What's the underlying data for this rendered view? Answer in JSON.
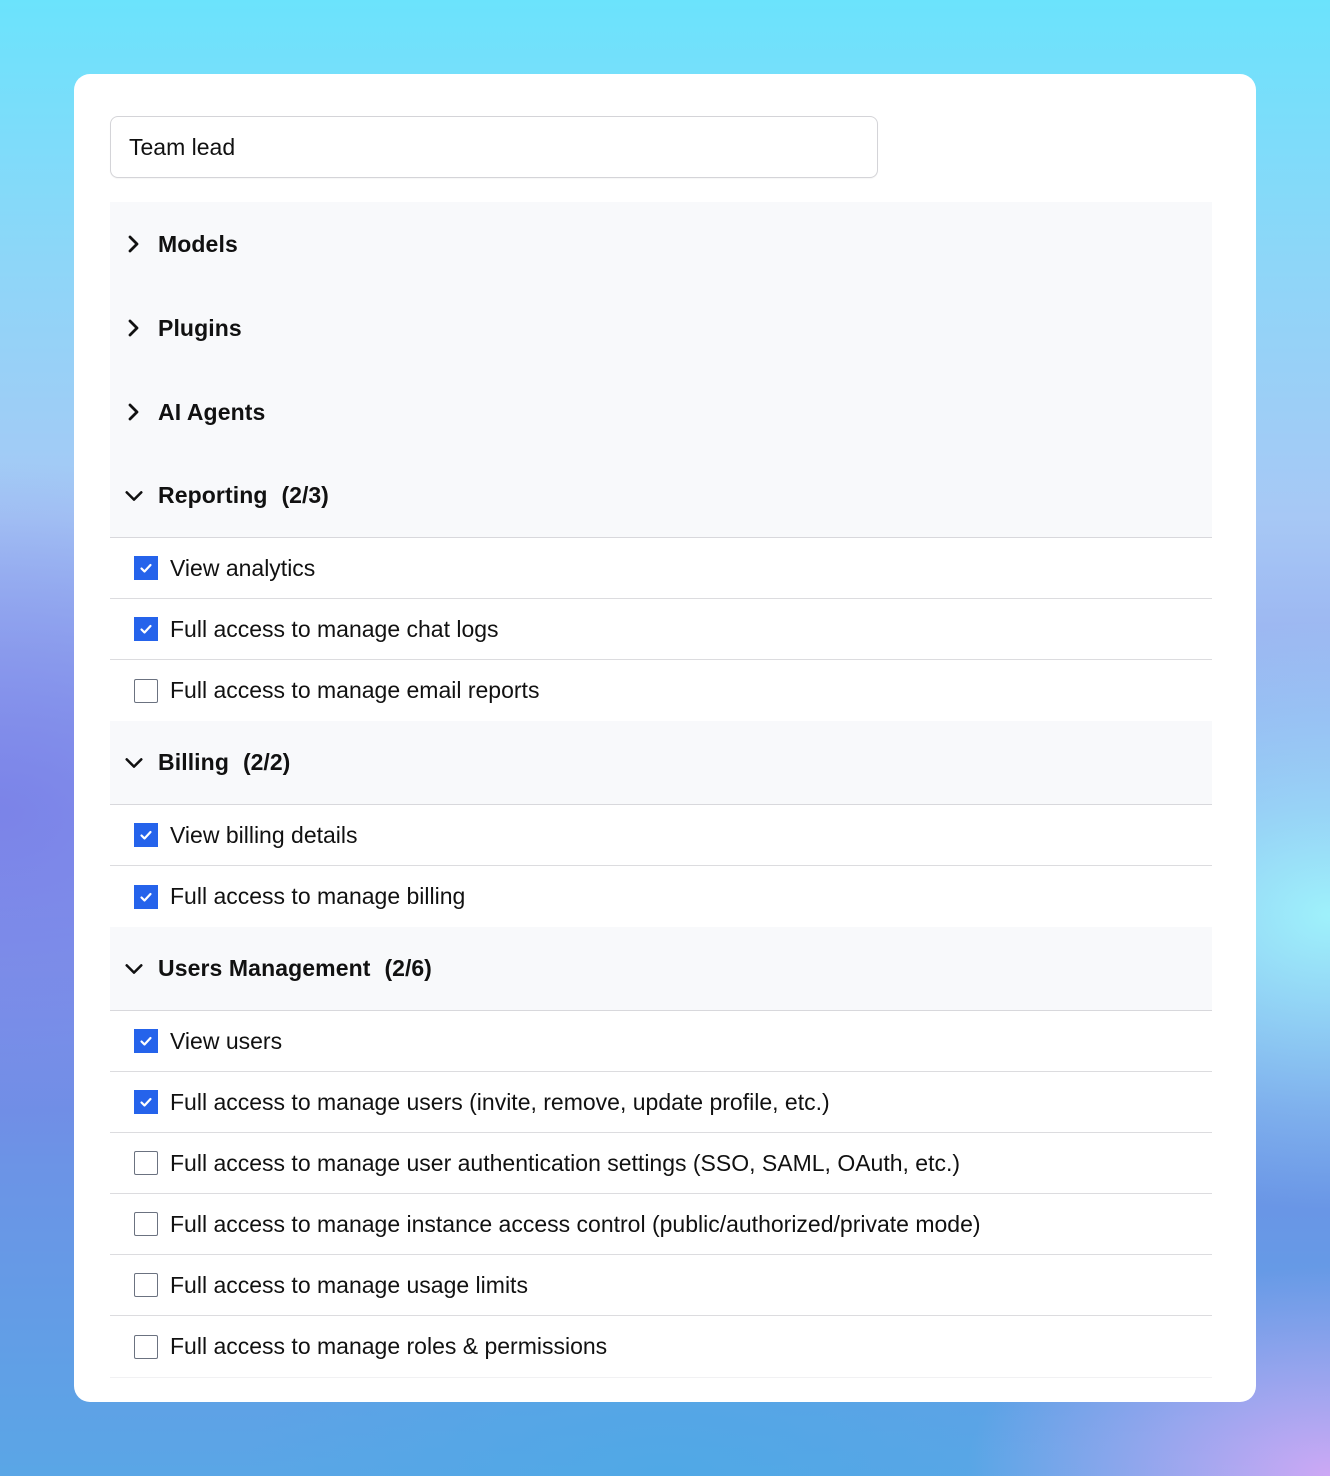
{
  "role_name": {
    "value": "Team lead"
  },
  "colors": {
    "accent": "#2563eb",
    "section_bg": "#f8f9fb",
    "divider": "#dcdcdf",
    "text": "#111111"
  },
  "sections": [
    {
      "title": "Models",
      "count": "",
      "expanded": false,
      "icon": "chevron-right-icon",
      "permissions": []
    },
    {
      "title": "Plugins",
      "count": "",
      "expanded": false,
      "icon": "chevron-right-icon",
      "permissions": []
    },
    {
      "title": "AI Agents",
      "count": "",
      "expanded": false,
      "icon": "chevron-right-icon",
      "permissions": []
    },
    {
      "title": "Reporting",
      "count": "(2/3)",
      "expanded": true,
      "icon": "chevron-down-icon",
      "permissions": [
        {
          "label": "View analytics",
          "checked": true
        },
        {
          "label": "Full access to manage chat logs",
          "checked": true
        },
        {
          "label": "Full access to manage email reports",
          "checked": false
        }
      ]
    },
    {
      "title": "Billing",
      "count": "(2/2)",
      "expanded": true,
      "icon": "chevron-down-icon",
      "permissions": [
        {
          "label": "View billing details",
          "checked": true
        },
        {
          "label": "Full access to manage billing",
          "checked": true
        }
      ]
    },
    {
      "title": "Users Management",
      "count": "(2/6)",
      "expanded": true,
      "icon": "chevron-down-icon",
      "permissions": [
        {
          "label": "View users",
          "checked": true
        },
        {
          "label": "Full access to manage users (invite, remove, update profile, etc.)",
          "checked": true
        },
        {
          "label": "Full access to manage user authentication settings (SSO, SAML, OAuth, etc.)",
          "checked": false
        },
        {
          "label": "Full access to manage instance access control (public/authorized/private mode)",
          "checked": false
        },
        {
          "label": "Full access to manage usage limits",
          "checked": false
        },
        {
          "label": "Full access to manage roles & permissions",
          "checked": false
        }
      ]
    }
  ]
}
